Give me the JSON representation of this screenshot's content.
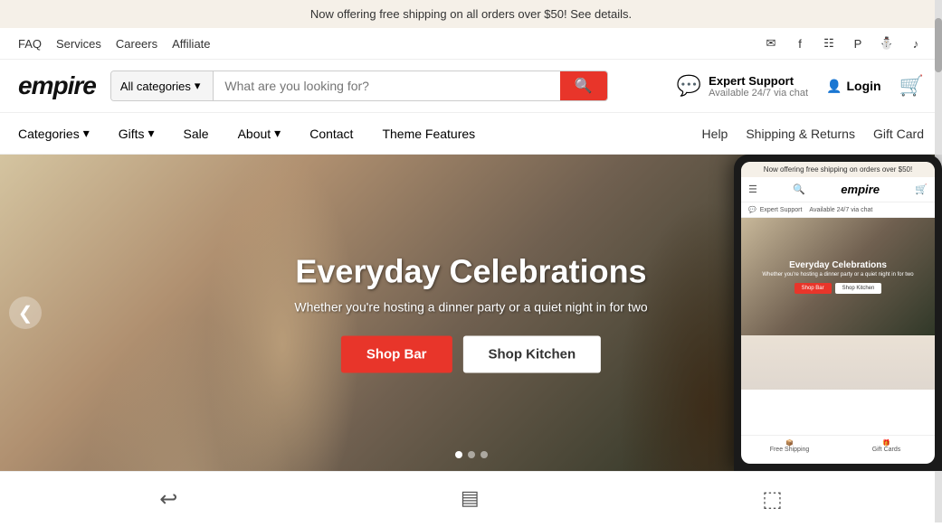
{
  "announcement": {
    "text": "Now offering free shipping on all orders over $50! See details."
  },
  "utility_nav": {
    "left_links": [
      "FAQ",
      "Services",
      "Careers",
      "Affiliate"
    ],
    "social_icons": [
      "mail",
      "facebook",
      "instagram",
      "pinterest",
      "snapchat",
      "tiktok"
    ]
  },
  "header": {
    "logo": "empire",
    "search": {
      "category": "All categories",
      "placeholder": "What are you looking for?"
    },
    "support": {
      "label": "Expert Support",
      "sublabel": "Available 24/7 via chat"
    },
    "login_label": "Login",
    "cart_icon": "cart"
  },
  "main_nav": {
    "left_items": [
      {
        "label": "Categories",
        "has_dropdown": true
      },
      {
        "label": "Gifts",
        "has_dropdown": true
      },
      {
        "label": "Sale"
      },
      {
        "label": "About",
        "has_dropdown": true
      },
      {
        "label": "Contact"
      },
      {
        "label": "Theme Features"
      }
    ],
    "right_items": [
      "Help",
      "Shipping & Returns",
      "Gift Card"
    ]
  },
  "hero": {
    "title": "Everyday Celebrations",
    "subtitle": "Whether you're hosting a dinner party or a quiet night in for two",
    "btn_primary": "Shop Bar",
    "btn_secondary": "Shop Kitchen",
    "dots": [
      true,
      false,
      false
    ]
  },
  "phone_mockup": {
    "announcement": "Now offering free shipping on orders over $50!",
    "logo": "empire",
    "support_label": "Expert Support",
    "support_sub": "Available 24/7 via chat",
    "hero_title": "Everyday Celebrations",
    "hero_sub": "Whether you're hosting a dinner party or a quiet night in for two",
    "btn_red": "Shop Bar",
    "btn_white": "Shop Kitchen",
    "footer_items": [
      "Free Shipping",
      "Gift Cards"
    ]
  },
  "bottom_strip": {
    "items": [
      {
        "icon": "↩",
        "label": ""
      },
      {
        "icon": "☰",
        "label": ""
      },
      {
        "icon": "□",
        "label": ""
      }
    ]
  }
}
